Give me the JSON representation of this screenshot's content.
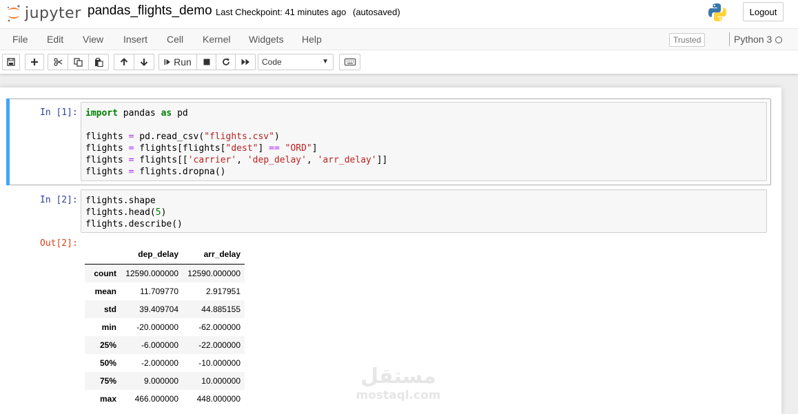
{
  "header": {
    "logo_text": "jupyter",
    "notebook_name": "pandas_flights_demo",
    "checkpoint": "Last Checkpoint: 41 minutes ago",
    "autosaved": "(autosaved)",
    "logout_label": "Logout"
  },
  "menubar": {
    "items": [
      "File",
      "Edit",
      "View",
      "Insert",
      "Cell",
      "Kernel",
      "Widgets",
      "Help"
    ],
    "trusted": "Trusted",
    "kernel_name": "Python 3"
  },
  "toolbar": {
    "run_label": "Run",
    "cell_type": "Code",
    "icons": [
      "save-icon",
      "plus-icon",
      "cut-icon",
      "copy-icon",
      "paste-icon",
      "arrow-up-icon",
      "arrow-down-icon",
      "step-forward-icon",
      "stop-icon",
      "restart-icon",
      "fast-forward-icon",
      "keyboard-icon"
    ]
  },
  "cells": [
    {
      "prompt": "In [1]:",
      "lines": [
        [
          {
            "t": "import",
            "c": "kw"
          },
          {
            "t": " pandas ",
            "c": ""
          },
          {
            "t": "as",
            "c": "kw"
          },
          {
            "t": " pd",
            "c": ""
          }
        ],
        [],
        [
          {
            "t": "flights ",
            "c": ""
          },
          {
            "t": "=",
            "c": "op"
          },
          {
            "t": " pd.read_csv(",
            "c": ""
          },
          {
            "t": "\"flights.csv\"",
            "c": "str"
          },
          {
            "t": ")",
            "c": ""
          }
        ],
        [
          {
            "t": "flights ",
            "c": ""
          },
          {
            "t": "=",
            "c": "op"
          },
          {
            "t": " flights[flights[",
            "c": ""
          },
          {
            "t": "\"dest\"",
            "c": "str"
          },
          {
            "t": "] ",
            "c": ""
          },
          {
            "t": "==",
            "c": "op"
          },
          {
            "t": " ",
            "c": ""
          },
          {
            "t": "\"ORD\"",
            "c": "str"
          },
          {
            "t": "]",
            "c": ""
          }
        ],
        [
          {
            "t": "flights ",
            "c": ""
          },
          {
            "t": "=",
            "c": "op"
          },
          {
            "t": " flights[[",
            "c": ""
          },
          {
            "t": "'carrier'",
            "c": "str"
          },
          {
            "t": ", ",
            "c": ""
          },
          {
            "t": "'dep_delay'",
            "c": "str"
          },
          {
            "t": ", ",
            "c": ""
          },
          {
            "t": "'arr_delay'",
            "c": "str"
          },
          {
            "t": "]]",
            "c": ""
          }
        ],
        [
          {
            "t": "flights ",
            "c": ""
          },
          {
            "t": "=",
            "c": "op"
          },
          {
            "t": " flights.dropna()",
            "c": ""
          }
        ]
      ]
    },
    {
      "prompt": "In [2]:",
      "lines": [
        [
          {
            "t": "flights.shape",
            "c": ""
          }
        ],
        [
          {
            "t": "flights.head(",
            "c": ""
          },
          {
            "t": "5",
            "c": "num"
          },
          {
            "t": ")",
            "c": ""
          }
        ],
        [
          {
            "t": "flights.describe()",
            "c": ""
          }
        ]
      ]
    }
  ],
  "output": {
    "prompt": "Out[2]:",
    "columns": [
      "dep_delay",
      "arr_delay"
    ],
    "rows": [
      {
        "index": "count",
        "values": [
          "12590.000000",
          "12590.000000"
        ]
      },
      {
        "index": "mean",
        "values": [
          "11.709770",
          "2.917951"
        ]
      },
      {
        "index": "std",
        "values": [
          "39.409704",
          "44.885155"
        ]
      },
      {
        "index": "min",
        "values": [
          "-20.000000",
          "-62.000000"
        ]
      },
      {
        "index": "25%",
        "values": [
          "-6.000000",
          "-22.000000"
        ]
      },
      {
        "index": "50%",
        "values": [
          "-2.000000",
          "-10.000000"
        ]
      },
      {
        "index": "75%",
        "values": [
          "9.000000",
          "10.000000"
        ]
      },
      {
        "index": "max",
        "values": [
          "466.000000",
          "448.000000"
        ]
      }
    ]
  },
  "watermark": {
    "arabic": "مستقل",
    "latin": "mostaql.com"
  }
}
